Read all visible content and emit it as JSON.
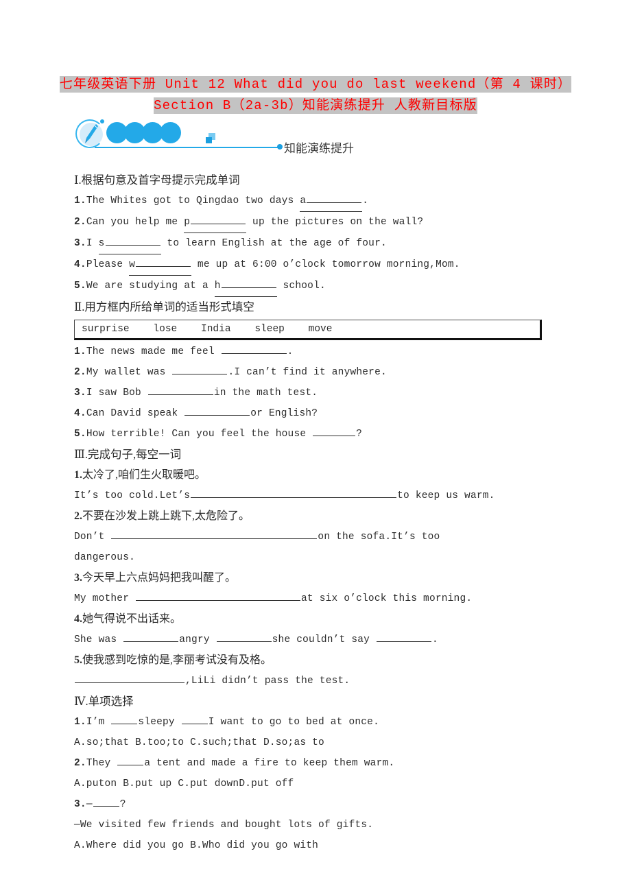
{
  "title": {
    "line1": "七年级英语下册 Unit 12 What did you do last weekend（第 4 课时）",
    "line2": "Section B（2a-3b）知能演练提升 人教新目标版"
  },
  "logo": {
    "label": "知能演练提升",
    "brush_icon": "paintbrush-icon",
    "accent_color": "#23a9e8",
    "disc_color": "#d6ecfa"
  },
  "sections": {
    "one": {
      "heading": "Ⅰ.根据句意及首字母提示完成单词",
      "items": [
        {
          "num": "1.",
          "pre": "The Whites got to Qingdao two days ",
          "hint": "a",
          "post": "."
        },
        {
          "num": "2.",
          "pre": "Can you help me ",
          "hint": "p",
          "post": " up the pictures on the wall?"
        },
        {
          "num": "3.",
          "pre": "I ",
          "hint": "s",
          "post": " to learn English at the age of four."
        },
        {
          "num": "4.",
          "pre": "Please ",
          "hint": "w",
          "post": " me up at 6:00 o’clock tomorrow morning,Mom."
        },
        {
          "num": "5.",
          "pre": "We are studying at a ",
          "hint": "h",
          "post": " school."
        }
      ]
    },
    "two": {
      "heading": "Ⅱ.用方框内所给单词的适当形式填空",
      "wordbank": "surprise    lose    India    sleep    move",
      "items": [
        {
          "num": "1.",
          "pre": "The news made me feel ",
          "post": "."
        },
        {
          "num": "2.",
          "pre": "My wallet was ",
          "post": ".I can’t find it anywhere."
        },
        {
          "num": "3.",
          "pre": "I saw Bob ",
          "post": "in the math test."
        },
        {
          "num": "4.",
          "pre": "Can David speak ",
          "post": "or English?"
        },
        {
          "num": "5.",
          "pre": "How terrible! Can you feel the house ",
          "post": "?"
        }
      ]
    },
    "three": {
      "heading": "Ⅲ.完成句子,每空一词",
      "items": [
        {
          "num": "1.",
          "cn": "太冷了,咱们生火取暖吧。",
          "en_pre": "It’s too cold.Let’s",
          "en_post": "to keep us warm.",
          "en_tail": ""
        },
        {
          "num": "2.",
          "cn": "不要在沙发上跳上跳下,太危险了。",
          "en_pre": "Don’t ",
          "en_post": "on the sofa.It’s too",
          "en_tail": "dangerous."
        },
        {
          "num": "3.",
          "cn": "今天早上六点妈妈把我叫醒了。",
          "en_pre": "My mother ",
          "en_post": "at six o’clock this morning.",
          "en_tail": ""
        },
        {
          "num": "4.",
          "cn": "她气得说不出话来。",
          "en_pre": "She was ",
          "en_mid1": "angry ",
          "en_mid2": "she couldn’t say ",
          "en_post": ".",
          "en_tail": ""
        },
        {
          "num": "5.",
          "cn": "使我感到吃惊的是,李丽考试没有及格。",
          "en_pre": "",
          "en_post": ",LiLi didn’t pass the test.",
          "en_tail": ""
        }
      ]
    },
    "four": {
      "heading": "Ⅳ.单项选择",
      "items": [
        {
          "num": "1.",
          "stem_pre": "I’m ",
          "stem_mid": "sleepy ",
          "stem_post": "I want to go to bed at once.",
          "choices": "A.so;that  B.too;to  C.such;that  D.so;as to"
        },
        {
          "num": "2.",
          "stem_pre": "They ",
          "stem_post": "a tent and made a fire to keep them warm.",
          "choices": "A.puton        B.put up    C.put downD.put off"
        },
        {
          "num": "3.",
          "stem_pre": "—",
          "stem_post": "?",
          "answer_line": "—We visited few friends and bought lots of gifts.",
          "choices": "A.Where did you go        B.Who did you go with"
        }
      ]
    }
  }
}
